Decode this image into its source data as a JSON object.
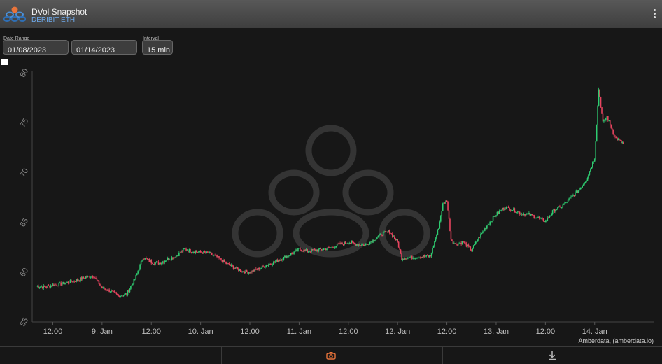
{
  "header": {
    "title": "DVol Snapshot",
    "subtitle": "DERIBIT ETH",
    "menu_icon": "kebab-menu-icon",
    "logo_icon": "amberdata-logo-icon"
  },
  "controls": {
    "date_range_label": "Date Range",
    "start_date": "01/08/2023",
    "end_date": "01/14/2023",
    "interval_label": "Interval",
    "interval_value": "15 min"
  },
  "footer": {
    "credit": "Amberdata, (amberdata.io)",
    "camera_icon": "camera-icon",
    "download_icon": "download-icon"
  },
  "colors": {
    "up": "#2ecc71",
    "down": "#e8445f",
    "accent": "#e8743b",
    "subtitle": "#6da8e8"
  },
  "chart_data": {
    "type": "candlestick",
    "title": "",
    "xlabel": "",
    "ylabel": "",
    "ylim": [
      55,
      80
    ],
    "yticks": [
      55,
      60,
      65,
      70,
      75,
      80
    ],
    "xlim": [
      "2023-01-08T08:00",
      "2023-01-14T13:00"
    ],
    "xticks": [
      {
        "t": "2023-01-08T12:00",
        "label": "12:00"
      },
      {
        "t": "2023-01-09T00:00",
        "label": "9. Jan"
      },
      {
        "t": "2023-01-09T12:00",
        "label": "12:00"
      },
      {
        "t": "2023-01-10T00:00",
        "label": "10. Jan"
      },
      {
        "t": "2023-01-10T12:00",
        "label": "12:00"
      },
      {
        "t": "2023-01-11T00:00",
        "label": "11. Jan"
      },
      {
        "t": "2023-01-11T12:00",
        "label": "12:00"
      },
      {
        "t": "2023-01-12T00:00",
        "label": "12. Jan"
      },
      {
        "t": "2023-01-12T12:00",
        "label": "12:00"
      },
      {
        "t": "2023-01-13T00:00",
        "label": "13. Jan"
      },
      {
        "t": "2023-01-13T12:00",
        "label": "12:00"
      },
      {
        "t": "2023-01-14T00:00",
        "label": "14. Jan"
      }
    ],
    "grid": false,
    "interval": "15 min",
    "series": [
      {
        "points": [
          [
            "2023-01-08T08:00",
            58.6
          ],
          [
            "2023-01-08T10:00",
            58.5
          ],
          [
            "2023-01-08T12:00",
            58.7
          ],
          [
            "2023-01-08T14:00",
            58.8
          ],
          [
            "2023-01-08T16:00",
            59.0
          ],
          [
            "2023-01-08T18:00",
            59.2
          ],
          [
            "2023-01-08T20:00",
            59.5
          ],
          [
            "2023-01-08T22:00",
            59.6
          ],
          [
            "2023-01-09T00:00",
            58.4
          ],
          [
            "2023-01-09T02:00",
            58.1
          ],
          [
            "2023-01-09T04:00",
            57.6
          ],
          [
            "2023-01-09T06:00",
            57.8
          ],
          [
            "2023-01-09T08:00",
            59.3
          ],
          [
            "2023-01-09T10:00",
            61.5
          ],
          [
            "2023-01-09T12:00",
            61.0
          ],
          [
            "2023-01-09T14:00",
            60.9
          ],
          [
            "2023-01-09T16:00",
            61.3
          ],
          [
            "2023-01-09T18:00",
            61.6
          ],
          [
            "2023-01-09T20:00",
            62.3
          ],
          [
            "2023-01-09T22:00",
            62.1
          ],
          [
            "2023-01-10T00:00",
            62.0
          ],
          [
            "2023-01-10T02:00",
            61.9
          ],
          [
            "2023-01-10T04:00",
            61.5
          ],
          [
            "2023-01-10T06:00",
            60.9
          ],
          [
            "2023-01-10T08:00",
            60.5
          ],
          [
            "2023-01-10T10:00",
            60.1
          ],
          [
            "2023-01-10T12:00",
            60.0
          ],
          [
            "2023-01-10T14:00",
            60.3
          ],
          [
            "2023-01-10T16:00",
            60.7
          ],
          [
            "2023-01-10T18:00",
            61.0
          ],
          [
            "2023-01-10T20:00",
            61.4
          ],
          [
            "2023-01-10T22:00",
            61.8
          ],
          [
            "2023-01-11T00:00",
            62.3
          ],
          [
            "2023-01-11T02:00",
            62.1
          ],
          [
            "2023-01-11T04:00",
            62.2
          ],
          [
            "2023-01-11T06:00",
            62.3
          ],
          [
            "2023-01-11T08:00",
            62.5
          ],
          [
            "2023-01-11T10:00",
            62.8
          ],
          [
            "2023-01-11T12:00",
            63.0
          ],
          [
            "2023-01-11T14:00",
            62.8
          ],
          [
            "2023-01-11T16:00",
            62.7
          ],
          [
            "2023-01-11T18:00",
            63.2
          ],
          [
            "2023-01-11T20:00",
            63.8
          ],
          [
            "2023-01-11T22:00",
            64.1
          ],
          [
            "2023-01-12T00:00",
            63.0
          ],
          [
            "2023-01-12T01:00",
            61.4
          ],
          [
            "2023-01-12T04:00",
            61.5
          ],
          [
            "2023-01-12T08:00",
            61.6
          ],
          [
            "2023-01-12T10:00",
            64.5
          ],
          [
            "2023-01-12T11:00",
            66.8
          ],
          [
            "2023-01-12T12:00",
            67.2
          ],
          [
            "2023-01-12T13:00",
            63.3
          ],
          [
            "2023-01-12T14:00",
            62.8
          ],
          [
            "2023-01-12T16:00",
            63.0
          ],
          [
            "2023-01-12T18:00",
            62.2
          ],
          [
            "2023-01-12T20:00",
            63.6
          ],
          [
            "2023-01-12T22:00",
            64.8
          ],
          [
            "2023-01-13T00:00",
            65.8
          ],
          [
            "2023-01-13T02:00",
            66.5
          ],
          [
            "2023-01-13T04:00",
            66.3
          ],
          [
            "2023-01-13T06:00",
            65.9
          ],
          [
            "2023-01-13T08:00",
            65.8
          ],
          [
            "2023-01-13T10:00",
            65.5
          ],
          [
            "2023-01-13T12:00",
            65.1
          ],
          [
            "2023-01-13T14:00",
            66.2
          ],
          [
            "2023-01-13T16:00",
            66.6
          ],
          [
            "2023-01-13T18:00",
            67.4
          ],
          [
            "2023-01-13T20:00",
            68.2
          ],
          [
            "2023-01-13T22:00",
            69.3
          ],
          [
            "2023-01-14T00:00",
            71.5
          ],
          [
            "2023-01-14T01:00",
            78.4
          ],
          [
            "2023-01-14T02:00",
            75.0
          ],
          [
            "2023-01-14T03:00",
            75.6
          ],
          [
            "2023-01-14T05:00",
            73.5
          ],
          [
            "2023-01-14T07:00",
            72.9
          ]
        ]
      }
    ]
  }
}
